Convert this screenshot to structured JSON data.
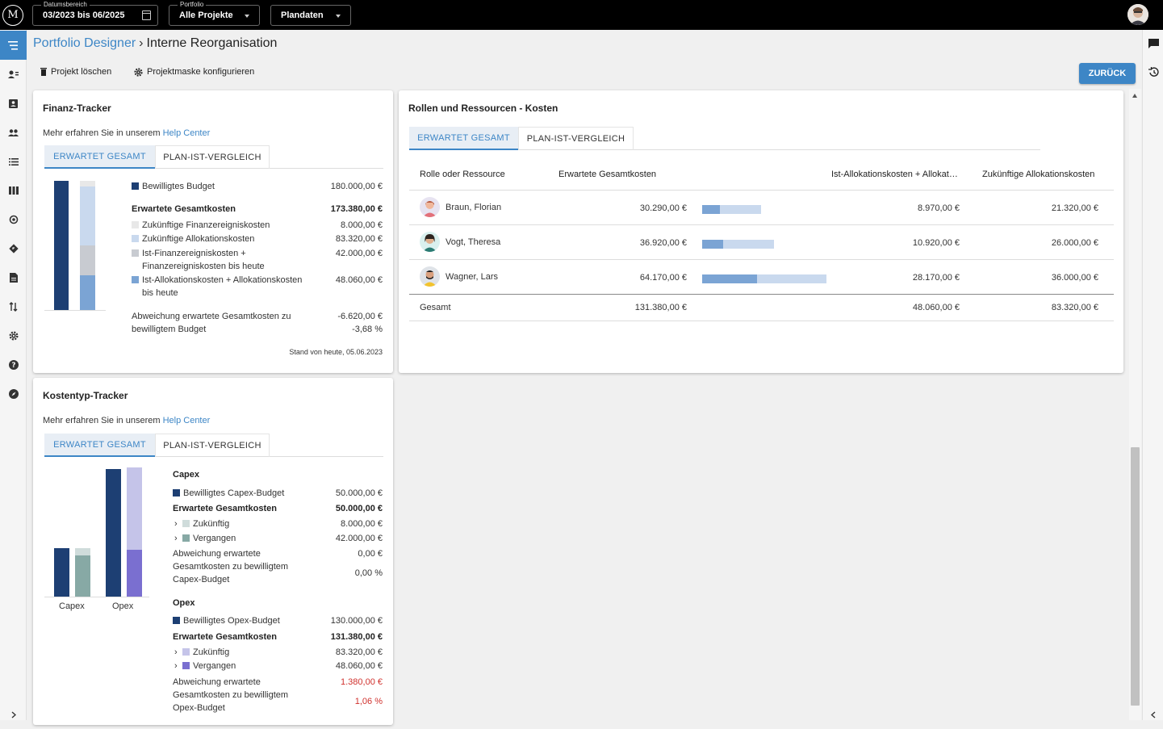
{
  "topbar": {
    "logo": "M",
    "date_range": {
      "label": "Datumsbereich",
      "value": "03/2023 bis 06/2025"
    },
    "portfolio": {
      "label": "Portfolio",
      "value": "Alle Projekte"
    },
    "plandaten": {
      "value": "Plandaten"
    }
  },
  "breadcrumb": {
    "parent": "Portfolio Designer",
    "separator": "›",
    "current": "Interne Reorganisation"
  },
  "toolbar": {
    "delete_label": "Projekt löschen",
    "configure_label": "Projektmaske konfigurieren",
    "back_label": "ZURÜCK"
  },
  "finanz": {
    "title": "Finanz-Tracker",
    "help_prefix": "Mehr erfahren Sie in unserem ",
    "help_link": "Help Center",
    "tab_active": "ERWARTET GESAMT",
    "tab_inactive": "PLAN-IST-VERGLEICH",
    "budget_label": "Bewilligtes Budget",
    "budget_value": "180.000,00 €",
    "expected_label": "Erwartete Gesamtkosten",
    "expected_value": "173.380,00 €",
    "items": [
      {
        "label": "Zukünftige Finanzereigniskosten",
        "value": "8.000,00 €",
        "color": "#e8e8e8"
      },
      {
        "label": "Zukünftige Allokationskosten",
        "value": "83.320,00 €",
        "color": "#c9d9ee"
      },
      {
        "label": "Ist-Finanzereigniskosten +",
        "label2": "Finanzereigniskosten bis heute",
        "value": "42.000,00 €",
        "color": "#c8cbd1"
      },
      {
        "label": "Ist-Allokationskosten + Allokationskosten",
        "label2": "bis heute",
        "value": "48.060,00 €",
        "color": "#7ba4d4"
      }
    ],
    "deviation_label": "Abweichung erwartete Gesamtkosten zu",
    "deviation_label2": "bewilligtem Budget",
    "deviation_value": "-6.620,00 €",
    "deviation_pct": "-3,68 %",
    "as_of": "Stand von heute, 05.06.2023"
  },
  "rollen": {
    "title": "Rollen und Ressourcen - Kosten",
    "tab_active": "ERWARTET GESAMT",
    "tab_inactive": "PLAN-IST-VERGLEICH",
    "headers": [
      "Rolle oder Ressource",
      "Erwartete Gesamtkosten",
      "Ist-Allokationskosten + Allokat…",
      "Zukünftige Allokationskosten"
    ],
    "rows": [
      {
        "name": "Braun, Florian",
        "total": "30.290,00 €",
        "actual": "8.970,00 €",
        "future": "21.320,00 €",
        "total_num": 30290,
        "actual_num": 8970
      },
      {
        "name": "Vogt, Theresa",
        "total": "36.920,00 €",
        "actual": "10.920,00 €",
        "future": "26.000,00 €",
        "total_num": 36920,
        "actual_num": 10920
      },
      {
        "name": "Wagner, Lars",
        "total": "64.170,00 €",
        "actual": "28.170,00 €",
        "future": "36.000,00 €",
        "total_num": 64170,
        "actual_num": 28170
      }
    ],
    "sum": {
      "label": "Gesamt",
      "total": "131.380,00 €",
      "actual": "48.060,00 €",
      "future": "83.320,00 €"
    }
  },
  "kosten": {
    "title": "Kostentyp-Tracker",
    "help_prefix": "Mehr erfahren Sie in unserem ",
    "help_link": "Help Center",
    "tab_active": "ERWARTET GESAMT",
    "tab_inactive": "PLAN-IST-VERGLEICH",
    "cat_labels": [
      "Capex",
      "Opex"
    ],
    "capex": {
      "title": "Capex",
      "budget_label": "Bewilligtes Capex-Budget",
      "budget_value": "50.000,00 €",
      "expected_label": "Erwartete Gesamtkosten",
      "expected_value": "50.000,00 €",
      "future_label": "Zukünftig",
      "future_value": "8.000,00 €",
      "past_label": "Vergangen",
      "past_value": "42.000,00 €",
      "dev_l1": "Abweichung erwartete",
      "dev_l2": "Gesamtkosten zu bewilligtem",
      "dev_l3": "Capex-Budget",
      "dev_value": "0,00 €",
      "dev_pct": "0,00 %"
    },
    "opex": {
      "title": "Opex",
      "budget_label": "Bewilligtes Opex-Budget",
      "budget_value": "130.000,00 €",
      "expected_label": "Erwartete Gesamtkosten",
      "expected_value": "131.380,00 €",
      "future_label": "Zukünftig",
      "future_value": "83.320,00 €",
      "past_label": "Vergangen",
      "past_value": "48.060,00 €",
      "dev_l1": "Abweichung erwartete",
      "dev_l2": "Gesamtkosten zu bewilligtem",
      "dev_l3": "Opex-Budget",
      "dev_value": "1.380,00 €",
      "dev_pct": "1,06 %"
    }
  },
  "colors": {
    "accent": "#3d86c6",
    "navy": "#1d3f73",
    "light_blue": "#c9d9ee",
    "mid_blue": "#7ba4d4",
    "grey": "#c8cbd1",
    "teal": "#87a9a5",
    "teal_light": "#cfdcdb",
    "lavender": "#c5c4e9",
    "purple": "#7a6fd0",
    "negative": "#d0312d"
  }
}
